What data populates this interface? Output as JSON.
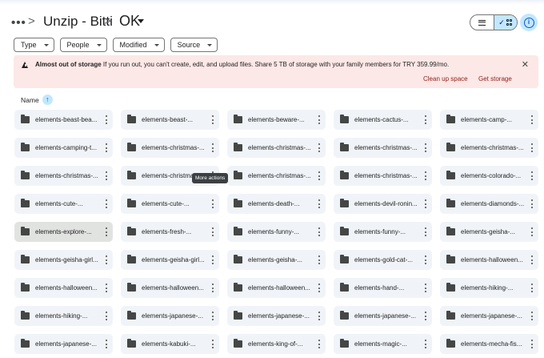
{
  "header": {
    "breadcrumb_parent": "Unzip - Bitti",
    "current_folder": "OK",
    "separator": ">"
  },
  "filters": [
    {
      "label": "Type"
    },
    {
      "label": "People"
    },
    {
      "label": "Modified"
    },
    {
      "label": "Source"
    }
  ],
  "banner": {
    "title": "Almost out of storage",
    "message": "If you run out, you can't create, edit, and upload files. Share 5 TB of storage with your family members for TRY 359.99/mo.",
    "action_primary": "Clean up space",
    "action_secondary": "Get storage",
    "close": "✕"
  },
  "sort": {
    "label": "Name",
    "direction_icon": "↑"
  },
  "tooltip": "More actions",
  "selected_item_index": 20,
  "items": [
    "elements-beast-bea...",
    "elements-beast-...",
    "elements-beware-...",
    "elements-cactus-...",
    "elements-camp-...",
    "elements-camping-t...",
    "elements-christmas-...",
    "elements-christmas-...",
    "elements-christmas-...",
    "elements-christmas-...",
    "elements-christmas-...",
    "elements-christmas-...",
    "elements-christmas-...",
    "elements-christmas-...",
    "elements-colorado-...",
    "elements-cute-...",
    "elements-cute-...",
    "elements-death-...",
    "elements-devil-ronin...",
    "elements-diamonds-...",
    "elements-explore-...",
    "elements-fresh-...",
    "elements-funny-...",
    "elements-funny-...",
    "elements-geisha-...",
    "elements-geisha-girl...",
    "elements-geisha-girl...",
    "elements-geisha-...",
    "elements-gold-cat-...",
    "elements-halloween...",
    "elements-halloween...",
    "elements-halloween...",
    "elements-halloween...",
    "elements-hand-...",
    "elements-hiking-...",
    "elements-hiking-...",
    "elements-japanese-...",
    "elements-japanese-...",
    "elements-japanese-...",
    "elements-japanese-...",
    "elements-japanese-...",
    "elements-kabuki-...",
    "elements-king-of-...",
    "elements-magic-...",
    "elements-mecha-fis..."
  ],
  "colors": {
    "accent": "#0b57d0",
    "card_bg": "#f0f4f9",
    "banner_bg": "#fce8e6",
    "selected_card_bg": "#e1e3e1"
  }
}
